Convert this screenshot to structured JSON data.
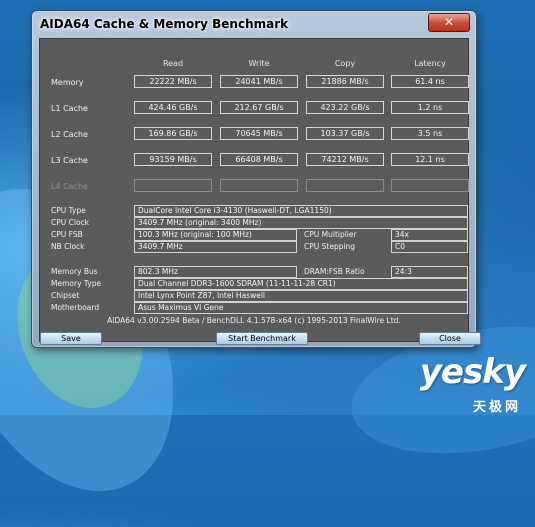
{
  "window": {
    "title": "AIDA64 Cache & Memory Benchmark",
    "close_glyph": "✕"
  },
  "columns": {
    "read": "Read",
    "write": "Write",
    "copy": "Copy",
    "latency": "Latency"
  },
  "rows": [
    {
      "label": "Memory",
      "read": "22222 MB/s",
      "write": "24041 MB/s",
      "copy": "21886 MB/s",
      "latency": "61.4 ns"
    },
    {
      "label": "L1 Cache",
      "read": "424.46 GB/s",
      "write": "212.67 GB/s",
      "copy": "423.22 GB/s",
      "latency": "1.2 ns"
    },
    {
      "label": "L2 Cache",
      "read": "169.86 GB/s",
      "write": "70645 MB/s",
      "copy": "103.37 GB/s",
      "latency": "3.5 ns"
    },
    {
      "label": "L3 Cache",
      "read": "93159 MB/s",
      "write": "66408 MB/s",
      "copy": "74212 MB/s",
      "latency": "12.1 ns"
    },
    {
      "label": "L4 Cache",
      "read": "",
      "write": "",
      "copy": "",
      "latency": ""
    }
  ],
  "cpu": {
    "type_label": "CPU Type",
    "type": "DualCore Intel Core i3-4130  (Haswell-DT, LGA1150)",
    "clock_label": "CPU Clock",
    "clock": "3409.7 MHz  (original: 3400 MHz)",
    "fsb_label": "CPU FSB",
    "fsb": "100.3 MHz  (original: 100 MHz)",
    "multiplier_label": "CPU Multiplier",
    "multiplier": "34x",
    "nb_label": "NB Clock",
    "nb": "3409.7 MHz",
    "stepping_label": "CPU Stepping",
    "stepping": "C0"
  },
  "memory": {
    "bus_label": "Memory Bus",
    "bus": "802.3 MHz",
    "ratio_label": "DRAM:FSB Ratio",
    "ratio": "24:3",
    "type_label": "Memory Type",
    "type": "Dual Channel DDR3-1600 SDRAM  (11-11-11-28 CR1)",
    "chipset_label": "Chipset",
    "chipset": "Intel Lynx Point Z87, Intel Haswell",
    "board_label": "Motherboard",
    "board": "Asus Maximus VI Gene"
  },
  "footer": "AIDA64 v3.00.2594 Beta / BenchDLL 4.1.578-x64  (c) 1995-2013 FinalWire Ltd.",
  "buttons": {
    "save": "Save",
    "start": "Start Benchmark",
    "close": "Close"
  },
  "watermark": {
    "main": "yesky",
    "sub": "天极网"
  }
}
